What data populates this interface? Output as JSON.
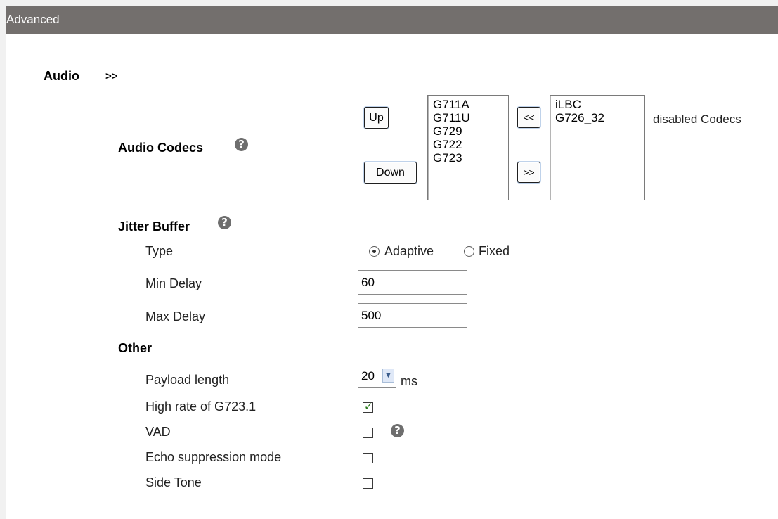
{
  "header": {
    "title": "Advanced"
  },
  "audio_section": {
    "label": "Audio",
    "arrow": ">>"
  },
  "audio_codecs": {
    "label": "Audio Codecs",
    "up_label": "Up",
    "down_label": "Down",
    "move_left_label": "<<",
    "move_right_label": ">>",
    "enabled": [
      "G711A",
      "G711U",
      "G729",
      "G722",
      "G723"
    ],
    "disabled": [
      "iLBC",
      "G726_32"
    ],
    "disabled_caption": "disabled Codecs"
  },
  "jitter_buffer": {
    "label": "Jitter Buffer",
    "type_label": "Type",
    "type_options": [
      "Adaptive",
      "Fixed"
    ],
    "type_selected": "Adaptive",
    "min_delay_label": "Min Delay",
    "min_delay_value": "60",
    "max_delay_label": "Max Delay",
    "max_delay_value": "500"
  },
  "other": {
    "label": "Other",
    "payload_label": "Payload length",
    "payload_value": "20",
    "payload_unit": "ms",
    "high_rate_label": "High rate of G723.1",
    "high_rate_checked": true,
    "vad_label": "VAD",
    "vad_checked": false,
    "echo_label": "Echo suppression mode",
    "echo_checked": false,
    "side_tone_label": "Side Tone",
    "side_tone_checked": false
  },
  "icons": {
    "help": "help-icon",
    "dropdown": "chevron-down-icon"
  },
  "colors": {
    "titlebar": "#736f6d",
    "background": "#f1f1f1",
    "panel": "#ffffff"
  }
}
